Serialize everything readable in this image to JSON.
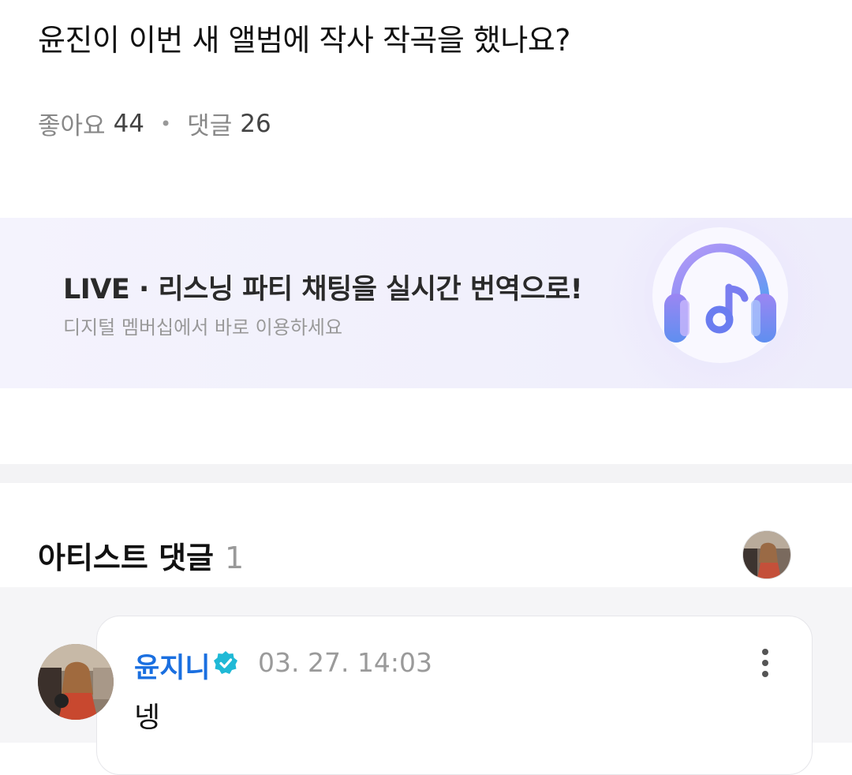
{
  "post": {
    "title": "윤진이 이번 새 앨범에 작사 작곡을 했나요?",
    "likes_label": "좋아요",
    "likes_count": "44",
    "comments_label": "댓글",
    "comments_count": "26"
  },
  "banner": {
    "title": "LIVE · 리스닝 파티 채팅을 실시간 번역으로!",
    "subtitle": "디지털 멤버십에서 바로 이용하세요",
    "icon": "headphones-music-icon"
  },
  "artist_comments": {
    "title": "아티스트 댓글",
    "count": "1",
    "items": [
      {
        "author": "윤지니",
        "verified": true,
        "timestamp": "03. 27. 14:03",
        "text": "넹"
      }
    ]
  },
  "colors": {
    "author_name": "#1a6fe0",
    "verified_badge": "#1fb9d6",
    "banner_bg": "#f1f0fc"
  }
}
